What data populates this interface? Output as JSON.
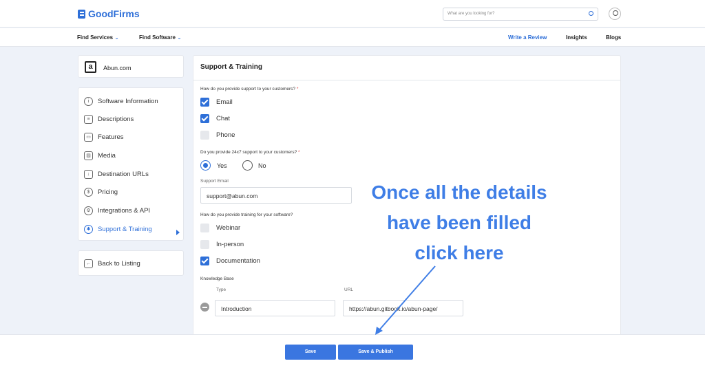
{
  "header": {
    "brand": "GoodFirms",
    "search_placeholder": "What are you looking for?"
  },
  "nav": {
    "find_services": "Find Services",
    "find_software": "Find Software",
    "write_review": "Write a Review",
    "insights": "Insights",
    "blogs": "Blogs"
  },
  "company": {
    "logo_letter": "a",
    "name": "Abun.com"
  },
  "sidebar": {
    "items": [
      {
        "label": "Software Information",
        "icon": "info-icon"
      },
      {
        "label": "Descriptions",
        "icon": "list-icon"
      },
      {
        "label": "Features",
        "icon": "window-icon"
      },
      {
        "label": "Media",
        "icon": "image-icon"
      },
      {
        "label": "Destination URLs",
        "icon": "link-icon"
      },
      {
        "label": "Pricing",
        "icon": "dollar-icon"
      },
      {
        "label": "Integrations & API",
        "icon": "gear-icon"
      },
      {
        "label": "Support & Training",
        "icon": "support-icon"
      }
    ],
    "back": "Back to Listing"
  },
  "form": {
    "title": "Support & Training",
    "q_support": "How do you provide support to your customers?",
    "support_options": [
      {
        "label": "Email",
        "checked": true
      },
      {
        "label": "Chat",
        "checked": true
      },
      {
        "label": "Phone",
        "checked": false
      }
    ],
    "q_24x7": "Do you provide 24x7 support to your customers?",
    "yes": "Yes",
    "no": "No",
    "selected_24x7": "Yes",
    "support_email_label": "Support Email",
    "support_email_value": "support@abun.com",
    "q_training": "How do you provide training for your software?",
    "training_options": [
      {
        "label": "Webinar",
        "checked": false
      },
      {
        "label": "In-person",
        "checked": false
      },
      {
        "label": "Documentation",
        "checked": true
      }
    ],
    "kb_label": "Knowledge Base",
    "kb_type_label": "Type",
    "kb_url_label": "URL",
    "kb_type_value": "Introduction",
    "kb_url_value": "https://abun.gitbook.io/abun-page/"
  },
  "footer": {
    "save": "Save",
    "save_publish": "Save & Publish"
  },
  "annotation": {
    "line1": "Once all the details",
    "line2": "have been filled",
    "line3": "click here"
  }
}
